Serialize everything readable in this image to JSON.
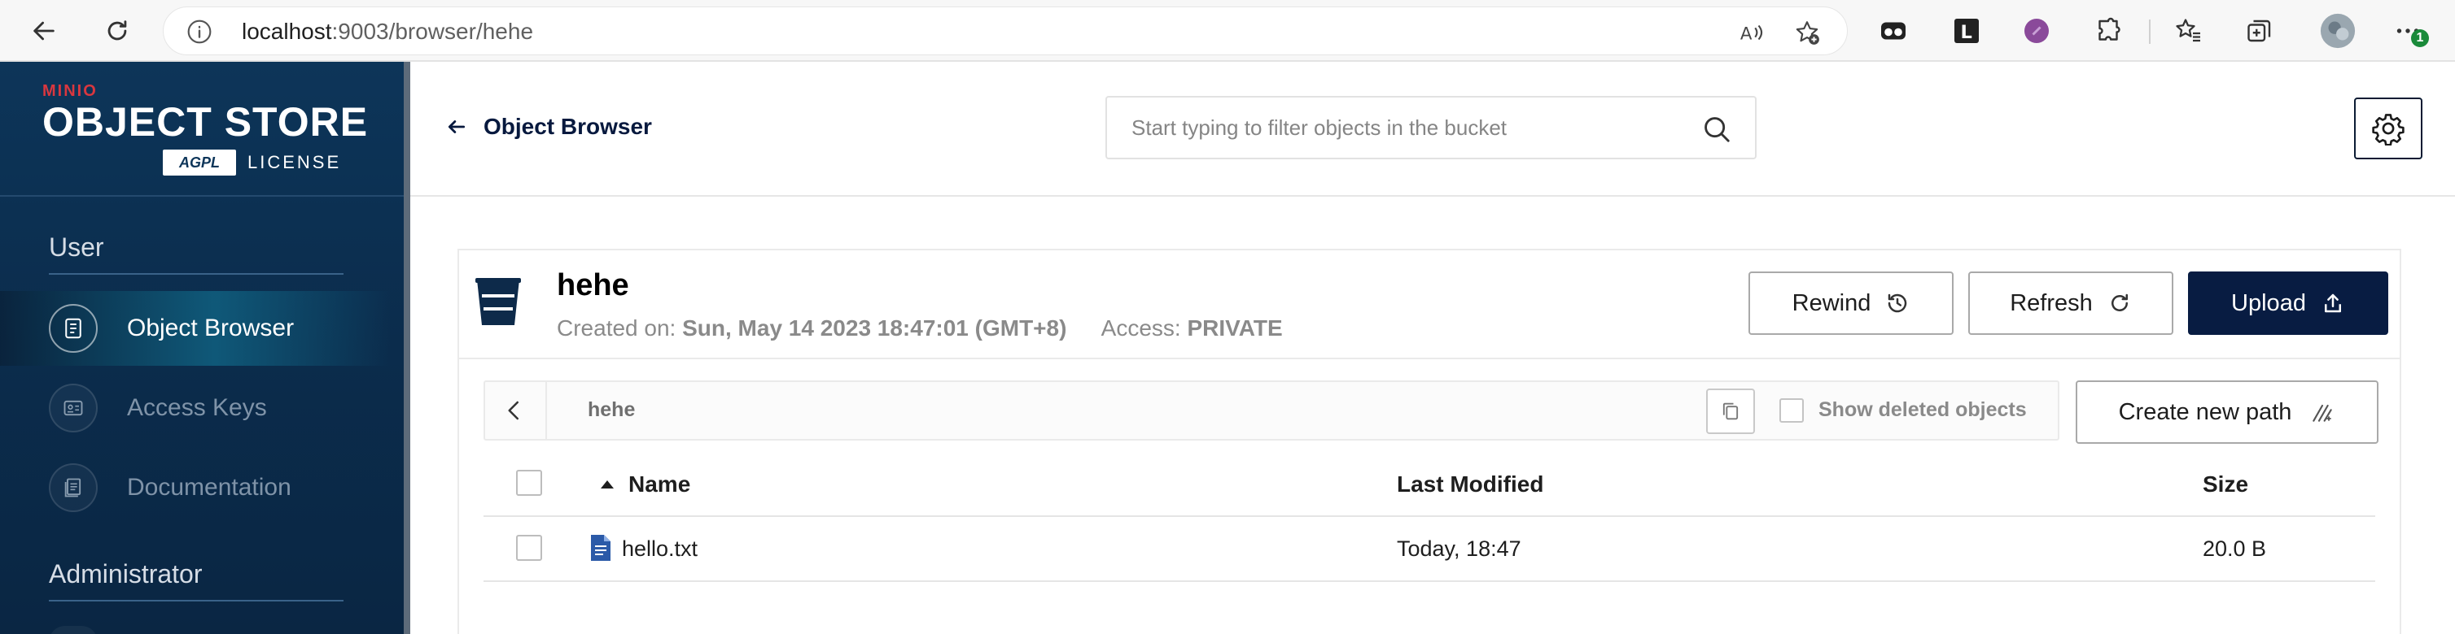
{
  "browser": {
    "url_host": "localhost",
    "url_rest": ":9003/browser/hehe",
    "ext_badge": "1"
  },
  "sidebar": {
    "logo": {
      "brand": "MINIO",
      "product": "OBJECT STORE",
      "badge": "AGPL",
      "license": "LICENSE"
    },
    "sections": [
      {
        "title": "User",
        "items": [
          {
            "label": "Object Browser",
            "icon": "object-browser-icon",
            "active": true
          },
          {
            "label": "Access Keys",
            "icon": "access-keys-icon",
            "active": false
          },
          {
            "label": "Documentation",
            "icon": "documentation-icon",
            "active": false
          }
        ]
      },
      {
        "title": "Administrator",
        "items": []
      }
    ]
  },
  "header": {
    "back_label": "Object Browser",
    "search_placeholder": "Start typing to filter objects in the bucket"
  },
  "bucket": {
    "name": "hehe",
    "created_label": "Created on:",
    "created_value": "Sun, May 14 2023 18:47:01 (GMT+8)",
    "access_label": "Access:",
    "access_value": "PRIVATE",
    "actions": {
      "rewind": "Rewind",
      "refresh": "Refresh",
      "upload": "Upload"
    }
  },
  "pathbar": {
    "crumb": "hehe",
    "show_deleted_label": "Show deleted objects",
    "create_path_label": "Create new path"
  },
  "table": {
    "columns": {
      "name": "Name",
      "modified": "Last Modified",
      "size": "Size"
    },
    "rows": [
      {
        "name": "hello.txt",
        "modified": "Today, 18:47",
        "size": "20.0 B"
      }
    ]
  },
  "colors": {
    "sidebar_bg": "#0d3559",
    "primary_button": "#081c42",
    "brand_red": "#d9373f"
  }
}
